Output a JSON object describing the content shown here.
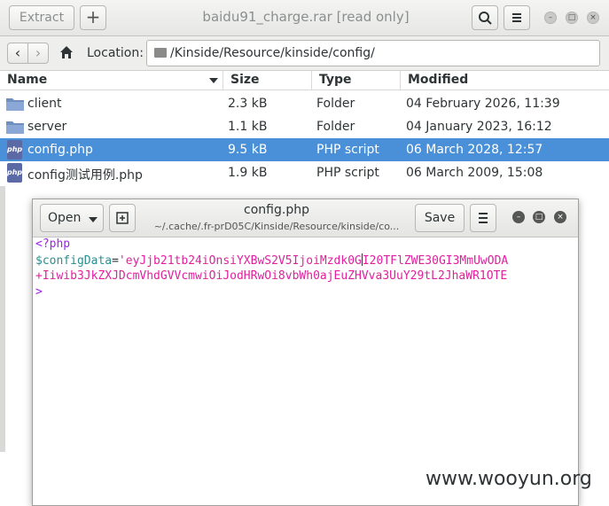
{
  "archive": {
    "extract_label": "Extract",
    "add_label": "+",
    "title": "baidu91_charge.rar [read only]",
    "location_label": "Location:",
    "location_path": "/Kinside/Resource/kinside/config/",
    "columns": [
      "Name",
      "Size",
      "Type",
      "Modified"
    ],
    "files": [
      {
        "name": "client",
        "size": "2.3 kB",
        "type": "Folder",
        "modified": "04 February 2026, 11:39",
        "icon": "folder-icon"
      },
      {
        "name": "server",
        "size": "1.1 kB",
        "type": "Folder",
        "modified": "04 January 2023, 16:12",
        "icon": "folder-icon"
      },
      {
        "name": "config.php",
        "size": "9.5 kB",
        "type": "PHP script",
        "modified": "06 March 2028, 12:57",
        "icon": "php-icon",
        "selected": true
      },
      {
        "name": "config测试用例.php",
        "size": "1.9 kB",
        "type": "PHP script",
        "modified": "06 March 2009, 15:08",
        "icon": "php-icon"
      }
    ],
    "php_icon_text": "php"
  },
  "editor": {
    "open_label": "Open",
    "save_label": "Save",
    "title": "config.php",
    "subtitle": "~/.cache/.fr-prD05C/Kinside/Resource/kinside/co...",
    "lines": {
      "line1": "<?php",
      "line2_var": "$configData",
      "line2_eq": "=",
      "line2_str_a": "'eyJjb21tb24iOnsiYXBwS2V5IjoiMzdk0G",
      "line2_str_b": "I20TFlZWE30GI3MmUwODA",
      "line3": "+Iiwib3JkZXJDcmVhdGVVcmwiOiJodHRwOi8vbWh0ajEuZHVva3UuY29tL2JhaWR1OTE",
      "line4": ">"
    }
  },
  "watermark": "www.wooyun.org",
  "colors": {
    "selection": "#4a90d9",
    "php_keyword": "#a020f0",
    "variable": "#2a8f8f",
    "string": "#e0209e"
  }
}
